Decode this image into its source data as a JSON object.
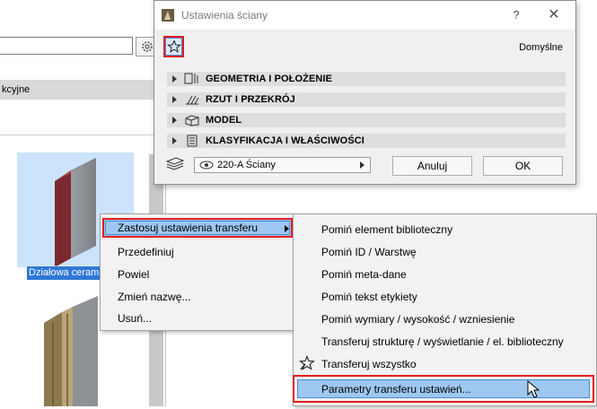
{
  "library": {
    "category_label": "kcyjne",
    "selected_item_label": "Działowa ceram"
  },
  "dialog": {
    "title": "Ustawienia ściany",
    "help": "?",
    "close": "✕",
    "favorites_icon": "star-icon",
    "default_label": "Domyślne",
    "sections": [
      {
        "label": "GEOMETRIA I POŁOŻENIE",
        "icon": "geometry-icon"
      },
      {
        "label": "RZUT I PRZEKRÓJ",
        "icon": "plan-section-icon"
      },
      {
        "label": "MODEL",
        "icon": "model-icon"
      },
      {
        "label": "KLASYFIKACJA I WŁAŚCIWOŚCI",
        "icon": "classification-icon"
      }
    ],
    "layer_value": "220-A Ściany",
    "cancel_label": "Anuluj",
    "ok_label": "OK"
  },
  "context_menu": {
    "items": [
      "Zastosuj ustawienia transferu",
      "Przedefiniuj",
      "Powiel",
      "Zmień nazwę...",
      "Usuń..."
    ]
  },
  "submenu": {
    "items": [
      "Pomiń element biblioteczny",
      "Pomiń ID / Warstwę",
      "Pomiń meta-dane",
      "Pomiń tekst etykiety",
      "Pomiń wymiary / wysokość / wzniesienie",
      "Transferuj strukturę / wyświetlanie / el. biblioteczny",
      "Transferuj wszystko",
      "Parametry transferu ustawień..."
    ]
  },
  "colors": {
    "highlight": "#9ec8f2",
    "outline_red": "#e0201e",
    "selection_blue": "#3078d6"
  }
}
